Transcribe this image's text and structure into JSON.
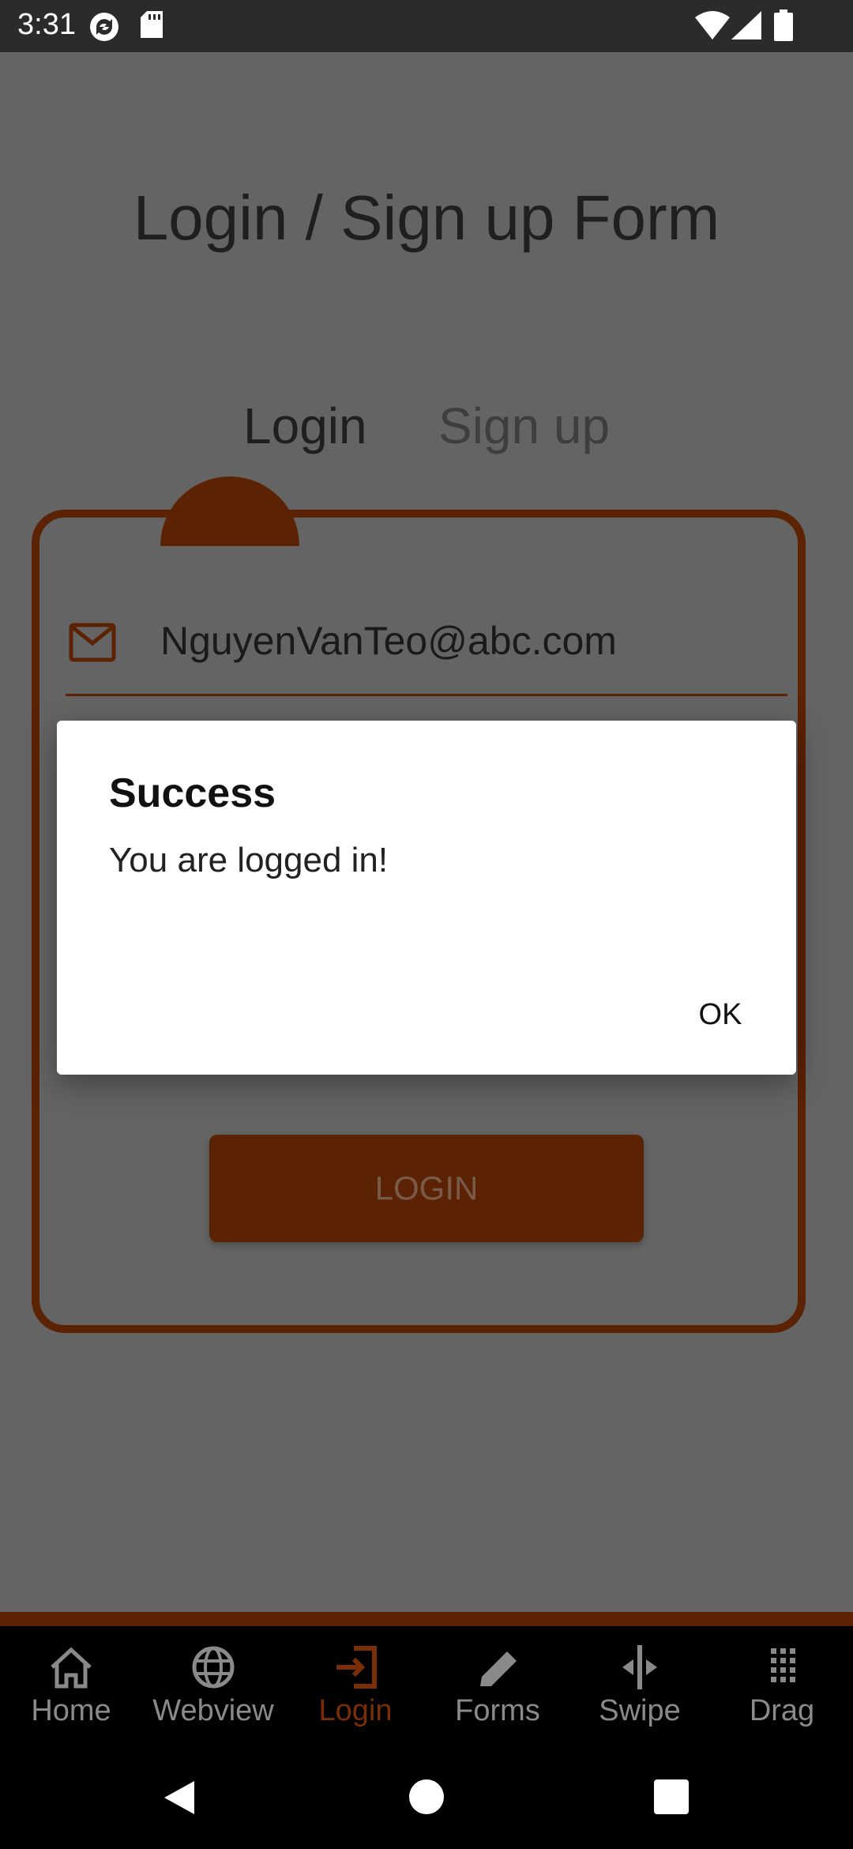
{
  "status_bar": {
    "time": "3:31",
    "icons": [
      "sync-icon",
      "sd-card-icon",
      "wifi-icon",
      "signal-icon",
      "battery-icon"
    ]
  },
  "screen": {
    "title": "Login / Sign up Form",
    "tabs": [
      {
        "label": "Login",
        "active": true
      },
      {
        "label": "Sign up",
        "active": false
      }
    ],
    "email_value": "NguyenVanTeo@abc.com",
    "login_button": "LOGIN",
    "accent_color": "#5c2204"
  },
  "dialog": {
    "title": "Success",
    "message": "You are logged in!",
    "ok_label": "OK"
  },
  "bottom_nav": {
    "items": [
      {
        "label": "Home",
        "icon": "home-icon",
        "active": false
      },
      {
        "label": "Webview",
        "icon": "globe-icon",
        "active": false
      },
      {
        "label": "Login",
        "icon": "login-icon",
        "active": true
      },
      {
        "label": "Forms",
        "icon": "pencil-icon",
        "active": false
      },
      {
        "label": "Swipe",
        "icon": "swipe-icon",
        "active": false
      },
      {
        "label": "Drag",
        "icon": "drag-grid-icon",
        "active": false
      }
    ]
  },
  "system_nav": {
    "buttons": [
      "back-icon",
      "home-circle-icon",
      "recents-icon"
    ]
  }
}
